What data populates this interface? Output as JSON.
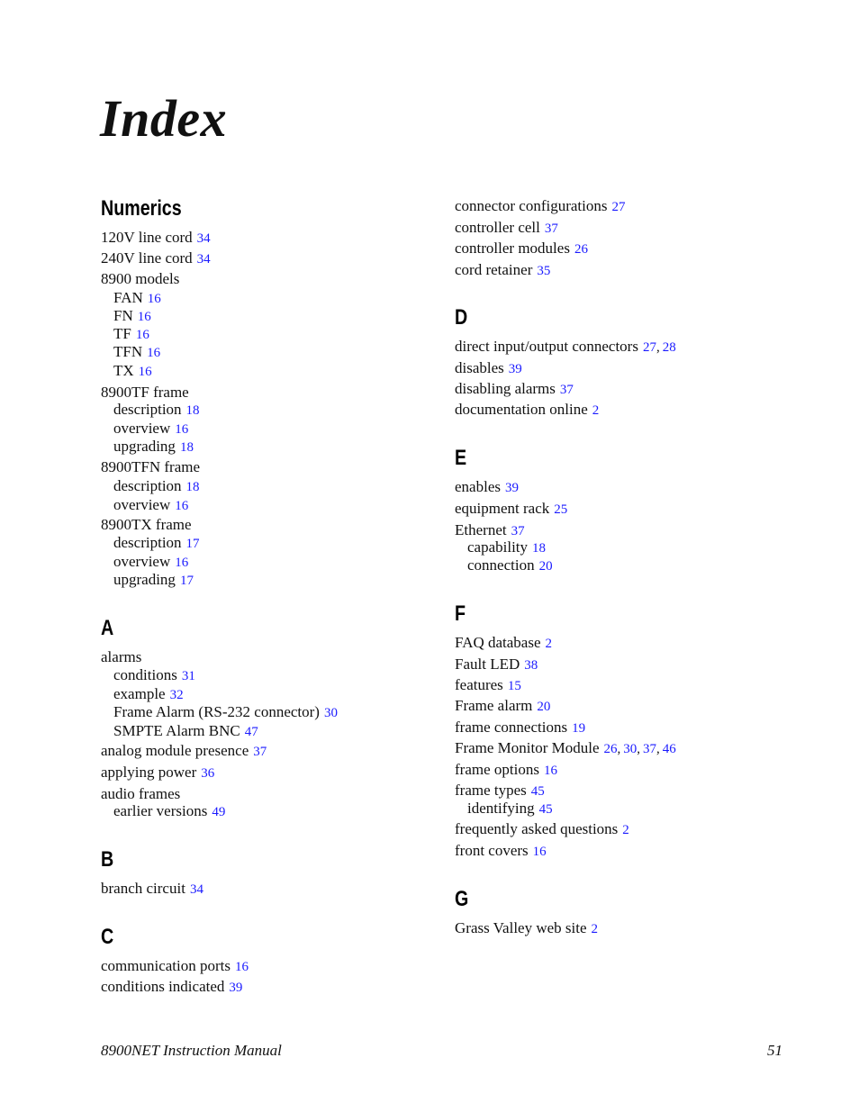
{
  "title": "Index",
  "left_column": [
    {
      "type": "heading",
      "text": "Numerics",
      "y": 0
    },
    {
      "type": "entry",
      "text": "120V line cord",
      "pages": [
        "34"
      ]
    },
    {
      "type": "entry",
      "text": "240V line cord",
      "pages": [
        "34"
      ]
    },
    {
      "type": "entry",
      "text": "8900 models",
      "pages": []
    },
    {
      "type": "sub",
      "text": "FAN",
      "pages": [
        "16"
      ]
    },
    {
      "type": "sub",
      "text": "FN",
      "pages": [
        "16"
      ]
    },
    {
      "type": "sub",
      "text": "TF",
      "pages": [
        "16"
      ]
    },
    {
      "type": "sub",
      "text": "TFN",
      "pages": [
        "16"
      ]
    },
    {
      "type": "sub",
      "text": "TX",
      "pages": [
        "16"
      ]
    },
    {
      "type": "entry",
      "text": "8900TF frame",
      "pages": []
    },
    {
      "type": "sub",
      "text": "description",
      "pages": [
        "18"
      ]
    },
    {
      "type": "sub",
      "text": "overview",
      "pages": [
        "16"
      ]
    },
    {
      "type": "sub",
      "text": "upgrading",
      "pages": [
        "18"
      ]
    },
    {
      "type": "entry",
      "text": "8900TFN frame",
      "pages": []
    },
    {
      "type": "sub",
      "text": "description",
      "pages": [
        "18"
      ]
    },
    {
      "type": "sub",
      "text": "overview",
      "pages": [
        "16"
      ]
    },
    {
      "type": "entry",
      "text": "8900TX frame",
      "pages": []
    },
    {
      "type": "sub",
      "text": "description",
      "pages": [
        "17"
      ]
    },
    {
      "type": "sub",
      "text": "overview",
      "pages": [
        "16"
      ]
    },
    {
      "type": "sub",
      "text": "upgrading",
      "pages": [
        "17"
      ]
    },
    {
      "type": "heading",
      "text": "A"
    },
    {
      "type": "entry",
      "text": "alarms",
      "pages": []
    },
    {
      "type": "sub",
      "text": "conditions",
      "pages": [
        "31"
      ]
    },
    {
      "type": "sub",
      "text": "example",
      "pages": [
        "32"
      ]
    },
    {
      "type": "sub",
      "text": "Frame Alarm (RS-232 connector)",
      "pages": [
        "30"
      ]
    },
    {
      "type": "sub",
      "text": "SMPTE Alarm BNC",
      "pages": [
        "47"
      ]
    },
    {
      "type": "entry",
      "text": "analog module presence",
      "pages": [
        "37"
      ]
    },
    {
      "type": "entry",
      "text": "applying power",
      "pages": [
        "36"
      ]
    },
    {
      "type": "entry",
      "text": "audio frames",
      "pages": []
    },
    {
      "type": "sub",
      "text": "earlier versions",
      "pages": [
        "49"
      ]
    },
    {
      "type": "heading",
      "text": "B"
    },
    {
      "type": "entry",
      "text": "branch circuit",
      "pages": [
        "34"
      ]
    },
    {
      "type": "heading",
      "text": "C"
    },
    {
      "type": "entry",
      "text": "communication ports",
      "pages": [
        "16"
      ]
    },
    {
      "type": "entry",
      "text": "conditions indicated",
      "pages": [
        "39"
      ]
    }
  ],
  "right_column": [
    {
      "type": "entry",
      "text": "connector configurations",
      "pages": [
        "27"
      ]
    },
    {
      "type": "entry",
      "text": "controller cell",
      "pages": [
        "37"
      ]
    },
    {
      "type": "entry",
      "text": "controller modules",
      "pages": [
        "26"
      ]
    },
    {
      "type": "entry",
      "text": "cord retainer",
      "pages": [
        "35"
      ]
    },
    {
      "type": "heading",
      "text": "D"
    },
    {
      "type": "entry",
      "text": "direct input/output connectors",
      "pages": [
        "27",
        "28"
      ]
    },
    {
      "type": "entry",
      "text": "disables",
      "pages": [
        "39"
      ]
    },
    {
      "type": "entry",
      "text": "disabling alarms",
      "pages": [
        "37"
      ]
    },
    {
      "type": "entry",
      "text": "documentation online",
      "pages": [
        "2"
      ]
    },
    {
      "type": "heading",
      "text": "E"
    },
    {
      "type": "entry",
      "text": "enables",
      "pages": [
        "39"
      ]
    },
    {
      "type": "entry",
      "text": "equipment rack",
      "pages": [
        "25"
      ]
    },
    {
      "type": "entry",
      "text": "Ethernet",
      "pages": [
        "37"
      ]
    },
    {
      "type": "sub",
      "text": "capability",
      "pages": [
        "18"
      ]
    },
    {
      "type": "sub",
      "text": "connection",
      "pages": [
        "20"
      ]
    },
    {
      "type": "heading",
      "text": "F"
    },
    {
      "type": "entry",
      "text": "FAQ database",
      "pages": [
        "2"
      ]
    },
    {
      "type": "entry",
      "text": "Fault LED",
      "pages": [
        "38"
      ]
    },
    {
      "type": "entry",
      "text": "features",
      "pages": [
        "15"
      ]
    },
    {
      "type": "entry",
      "text": "Frame alarm",
      "pages": [
        "20"
      ]
    },
    {
      "type": "entry",
      "text": "frame connections",
      "pages": [
        "19"
      ]
    },
    {
      "type": "entry",
      "text": "Frame Monitor Module",
      "pages": [
        "26",
        "30",
        "37",
        "46"
      ]
    },
    {
      "type": "entry",
      "text": "frame options",
      "pages": [
        "16"
      ]
    },
    {
      "type": "entry",
      "text": "frame types",
      "pages": [
        "45"
      ]
    },
    {
      "type": "sub",
      "text": "identifying",
      "pages": [
        "45"
      ]
    },
    {
      "type": "entry",
      "text": "frequently asked questions",
      "pages": [
        "2"
      ]
    },
    {
      "type": "entry",
      "text": "front covers",
      "pages": [
        "16"
      ]
    },
    {
      "type": "heading",
      "text": "G"
    },
    {
      "type": "entry",
      "text": "Grass Valley web site",
      "pages": [
        "2"
      ]
    }
  ],
  "footer": {
    "manual_title": "8900NET  Instruction Manual",
    "page_number": "51"
  },
  "colors": {
    "link": "#1a1aff",
    "text": "#111111"
  }
}
